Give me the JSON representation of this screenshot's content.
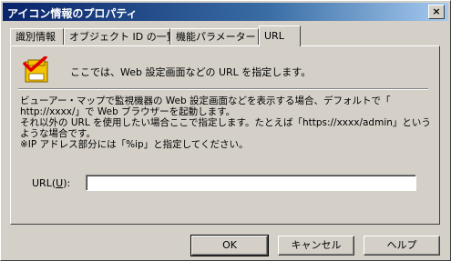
{
  "window": {
    "title": "アイコン情報のプロパティ",
    "close_label": "×"
  },
  "tabs": [
    {
      "label": "識別情報"
    },
    {
      "label": "オブジェクト ID の一覧"
    },
    {
      "label": "機能パラメーター"
    },
    {
      "label": "URL"
    }
  ],
  "active_tab": 3,
  "panel": {
    "header_text": "ここでは、Web 設定画面などの URL を指定します。",
    "header_icon": "checklist-icon",
    "description_lines": [
      "ビューアー・マップで監視機器の Web 設定画面などを表示する場合、デフォルトで「",
      "http://xxxx/」で Web ブラウザーを起動します。",
      "それ以外の URL を使用したい場合ここで指定します。たとえば「https://xxxx/admin」という",
      "ような場合です。",
      "※IP アドレス部分には「%ip」と指定してください。"
    ],
    "url_label_prefix": "URL(",
    "url_label_accel": "U",
    "url_label_suffix": "):",
    "url_value": ""
  },
  "buttons": {
    "ok": "OK",
    "cancel": "キャンセル",
    "help": "ヘルプ"
  },
  "colors": {
    "titlebar_start": "#0a246a",
    "titlebar_end": "#a6caf0",
    "face": "#d4d0c8"
  }
}
